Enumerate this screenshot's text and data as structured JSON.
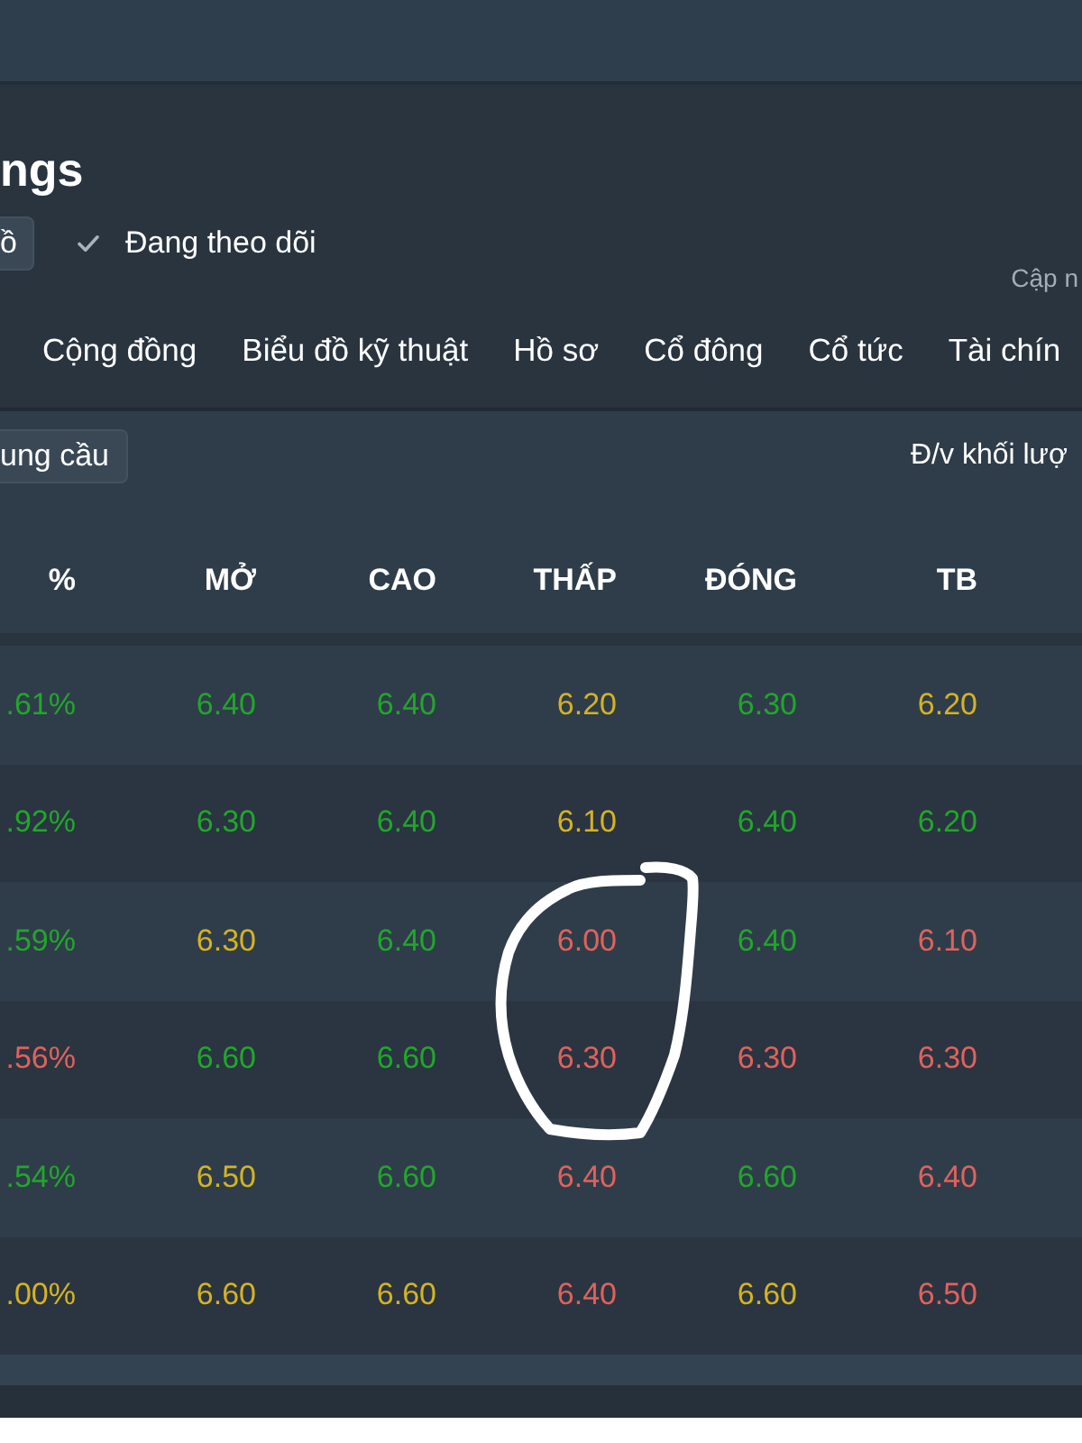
{
  "header": {
    "title": "ngs",
    "button": "ồ",
    "follow": {
      "label": "Đang theo dõi",
      "checked": true
    },
    "update_note": "Cập n"
  },
  "tabs": [
    {
      "label": "Cộng đồng",
      "selected": false
    },
    {
      "label": "Biểu đồ kỹ thuật",
      "selected": false
    },
    {
      "label": "Hồ sơ",
      "selected": false
    },
    {
      "label": "Cổ đông",
      "selected": false
    },
    {
      "label": "Cổ tức",
      "selected": false
    },
    {
      "label": "Tài chín",
      "selected": false
    }
  ],
  "toolbar": {
    "button": "ung cầu",
    "unit_label": "Đ/v khối lượ"
  },
  "table": {
    "columns": [
      "%",
      "MỞ",
      "CAO",
      "THẤP",
      "ĐÓNG",
      "TB"
    ],
    "rows": [
      {
        "cells": [
          {
            "text": ".61%",
            "color": "#21a62b"
          },
          {
            "text": "6.40",
            "color": "#21a62b"
          },
          {
            "text": "6.40",
            "color": "#21a62b"
          },
          {
            "text": "6.20",
            "color": "#d4b322"
          },
          {
            "text": "6.30",
            "color": "#21a62b"
          },
          {
            "text": "6.20",
            "color": "#d4b322"
          }
        ]
      },
      {
        "cells": [
          {
            "text": ".92%",
            "color": "#21a62b"
          },
          {
            "text": "6.30",
            "color": "#21a62b"
          },
          {
            "text": "6.40",
            "color": "#21a62b"
          },
          {
            "text": "6.10",
            "color": "#d4b322"
          },
          {
            "text": "6.40",
            "color": "#21a62b"
          },
          {
            "text": "6.20",
            "color": "#21a62b"
          }
        ]
      },
      {
        "cells": [
          {
            "text": ".59%",
            "color": "#21a62b"
          },
          {
            "text": "6.30",
            "color": "#d4b322"
          },
          {
            "text": "6.40",
            "color": "#21a62b"
          },
          {
            "text": "6.00",
            "color": "#e0625c"
          },
          {
            "text": "6.40",
            "color": "#21a62b"
          },
          {
            "text": "6.10",
            "color": "#e0625c"
          }
        ]
      },
      {
        "cells": [
          {
            "text": ".56%",
            "color": "#e0625c"
          },
          {
            "text": "6.60",
            "color": "#21a62b"
          },
          {
            "text": "6.60",
            "color": "#21a62b"
          },
          {
            "text": "6.30",
            "color": "#e0625c"
          },
          {
            "text": "6.30",
            "color": "#e0625c"
          },
          {
            "text": "6.30",
            "color": "#e0625c"
          }
        ]
      },
      {
        "cells": [
          {
            "text": ".54%",
            "color": "#21a62b"
          },
          {
            "text": "6.50",
            "color": "#d4b322"
          },
          {
            "text": "6.60",
            "color": "#21a62b"
          },
          {
            "text": "6.40",
            "color": "#e0625c"
          },
          {
            "text": "6.60",
            "color": "#21a62b"
          },
          {
            "text": "6.40",
            "color": "#e0625c"
          }
        ]
      },
      {
        "cells": [
          {
            "text": ".00%",
            "color": "#d4b322"
          },
          {
            "text": "6.60",
            "color": "#d4b322"
          },
          {
            "text": "6.60",
            "color": "#d4b322"
          },
          {
            "text": "6.40",
            "color": "#e0625c"
          },
          {
            "text": "6.60",
            "color": "#d4b322"
          },
          {
            "text": "6.50",
            "color": "#e0625c"
          }
        ]
      }
    ]
  }
}
